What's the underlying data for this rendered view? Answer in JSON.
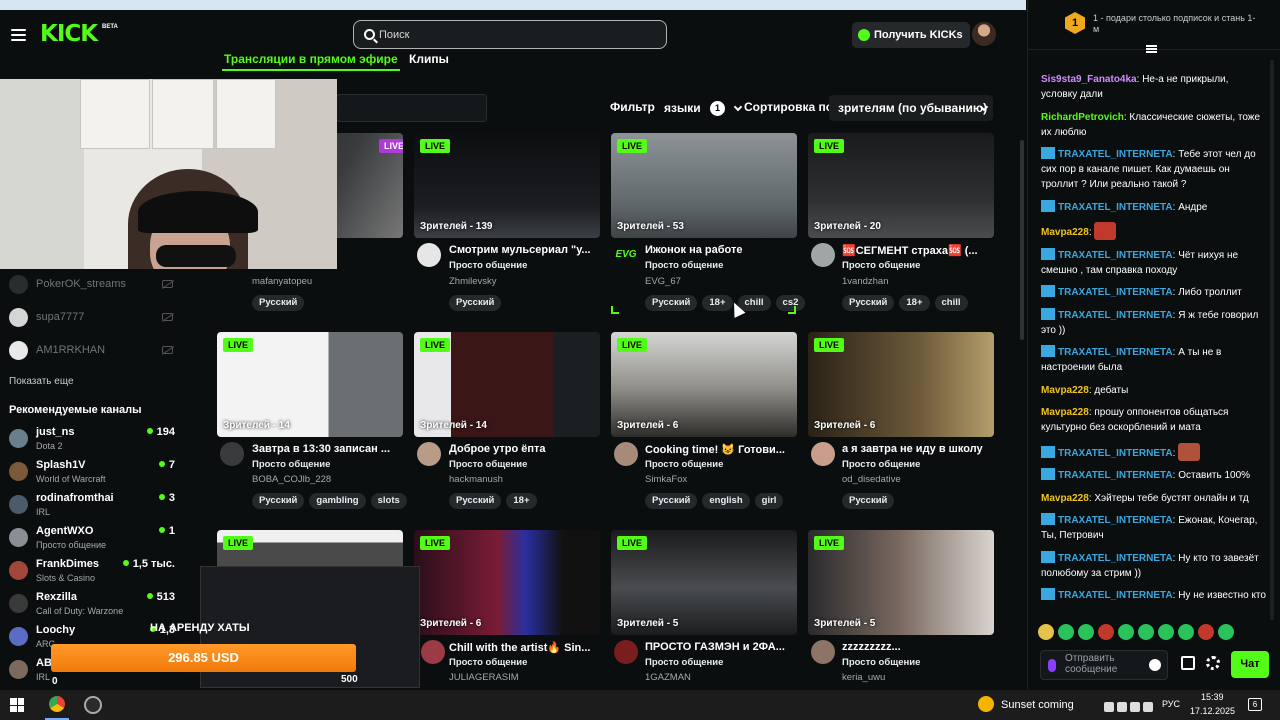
{
  "header": {
    "logo": "KICK",
    "logo_beta": "BETA",
    "search_placeholder": "Поиск",
    "get_kicks": "Получить KICKs"
  },
  "tabs": {
    "live": "Трансляции в прямом эфире",
    "clips": "Клипы"
  },
  "filters": {
    "filter_label": "Фильтр",
    "languages_label": "языки",
    "languages_count": "1",
    "sort_label": "Сортировка по",
    "sort_value": "зрителям (по убыванию)"
  },
  "sidebar": {
    "followed": [
      {
        "name": "PokerOK_streams"
      },
      {
        "name": "supa7777"
      },
      {
        "name": "AM1RRKHAN"
      }
    ],
    "show_more": "Показать еще",
    "recommended_title": "Рекомендуемые каналы",
    "recommended": [
      {
        "name": "just_ns",
        "category": "Dota 2",
        "viewers": "194"
      },
      {
        "name": "Splash1V",
        "category": "World of Warcraft",
        "viewers": "7"
      },
      {
        "name": "rodinafromthai",
        "category": "IRL",
        "viewers": "3"
      },
      {
        "name": "AgentWXO",
        "category": "Просто общение",
        "viewers": "1"
      },
      {
        "name": "FrankDimes",
        "category": "Slots & Casino",
        "viewers": "1,5 тыс."
      },
      {
        "name": "Rexzilla",
        "category": "Call of Duty: Warzone",
        "viewers": "513"
      },
      {
        "name": "Loochy",
        "category": "ARC",
        "viewers": "1,3"
      },
      {
        "name": "AB",
        "category": "IRL",
        "viewers": ""
      }
    ]
  },
  "streams": [
    {
      "live": "LIVE",
      "viewers": "",
      "title": "",
      "category": "",
      "user": "mafanyatopeu",
      "tags": [
        "Русский"
      ]
    },
    {
      "live": "LIVE",
      "viewers": "Зрителей - 139",
      "title": "Смотрим мульсериал \"у...",
      "category": "Просто общение",
      "user": "Zhmilevsky",
      "tags": [
        "Русский"
      ]
    },
    {
      "live": "LIVE",
      "viewers": "Зрителей - 53",
      "title": "Ижонок на работе",
      "category": "Просто общение",
      "user": "EVG_67",
      "avatar_text": "EVG",
      "tags": [
        "Русский",
        "18+",
        "chill",
        "cs2"
      ]
    },
    {
      "live": "LIVE",
      "viewers": "Зрителей - 20",
      "title": "🆘СЕГМЕНТ страха🆘 (...",
      "category": "Просто общение",
      "user": "1vandzhan",
      "tags": [
        "Русский",
        "18+",
        "chill"
      ]
    },
    {
      "live": "LIVE",
      "viewers": "Зрителей - 14",
      "title": "Завтра в 13:30 записан ...",
      "category": "Просто общение",
      "user": "BOBA_COJlb_228",
      "tags": [
        "Русский",
        "gambling",
        "slots"
      ]
    },
    {
      "live": "LIVE",
      "viewers": "Зрителей - 14",
      "title": "Доброе утро ёпта",
      "category": "Просто общение",
      "user": "hackmanush",
      "tags": [
        "Русский",
        "18+"
      ]
    },
    {
      "live": "LIVE",
      "viewers": "Зрителей - 6",
      "title": "Cooking time! 😺 Готови...",
      "category": "Просто общение",
      "user": "SimkaFox",
      "tags": [
        "Русский",
        "english",
        "girl"
      ]
    },
    {
      "live": "LIVE",
      "viewers": "Зрителей - 6",
      "title": "а я завтра не иду в школу",
      "category": "Просто общение",
      "user": "od_disedative",
      "tags": [
        "Русский"
      ]
    },
    {
      "live": "LIVE",
      "viewers": "",
      "title": "",
      "category": "",
      "user": "",
      "tags": []
    },
    {
      "live": "LIVE",
      "viewers": "Зрителей - 6",
      "title": "Chill with the artist🔥 Sin...",
      "category": "Просто общение",
      "user": "JULIAGERASIM",
      "tags": []
    },
    {
      "live": "LIVE",
      "viewers": "Зрителей - 5",
      "title": "ПРОСТО ГАЗМЭН и 2ФА...",
      "category": "Просто общение",
      "user": "1GAZMAN",
      "tags": []
    },
    {
      "live": "LIVE",
      "viewers": "Зрителей - 5",
      "title": "zzzzzzzzz...",
      "category": "Просто общение",
      "user": "keria_uwu",
      "tags": []
    }
  ],
  "overlay": {
    "rent_text": "НА АРЕНДУ ХАТЫ",
    "donation": "296.85 USD",
    "counter": "500",
    "zero": "0"
  },
  "chat": {
    "rank": "1",
    "rank_text": "1 - подари столько подписок и стань 1-м",
    "messages": [
      {
        "user": "Sis9sta9_Fanato4ka",
        "color": "#d08cff",
        "badge": false,
        "text": "Не-а не прикрыли, условку дали"
      },
      {
        "user": "RichardPetrovich",
        "color": "#53fc18",
        "badge": false,
        "text": "Классические сюжеты, тоже их люблю"
      },
      {
        "user": "TRAXATEL_INTERNETA",
        "color": "#3aa8e0",
        "badge": true,
        "text": "Тебе этот чел до сих пор в канале пишет. Как думаешь он троллит ? Или реально такой ?"
      },
      {
        "user": "TRAXATEL_INTERNETA",
        "color": "#3aa8e0",
        "badge": true,
        "text": "Андре"
      },
      {
        "user": "Mavpa228",
        "color": "#f0c419",
        "badge": false,
        "text": "",
        "emote": true
      },
      {
        "user": "TRAXATEL_INTERNETA",
        "color": "#3aa8e0",
        "badge": true,
        "text": "Чёт нихуя не смешно , там справка походу"
      },
      {
        "user": "TRAXATEL_INTERNETA",
        "color": "#3aa8e0",
        "badge": true,
        "text": "Либо троллит"
      },
      {
        "user": "TRAXATEL_INTERNETA",
        "color": "#3aa8e0",
        "badge": true,
        "text": "Я ж тебе говорил это ))"
      },
      {
        "user": "TRAXATEL_INTERNETA",
        "color": "#3aa8e0",
        "badge": true,
        "text": "А ты не в настроении была"
      },
      {
        "user": "Mavpa228",
        "color": "#f0c419",
        "badge": false,
        "text": "дебаты"
      },
      {
        "user": "Mavpa228",
        "color": "#f0c419",
        "badge": false,
        "text": "прошу оппонентов общаться культурно без оскорблений и мата"
      },
      {
        "user": "TRAXATEL_INTERNETA",
        "color": "#3aa8e0",
        "badge": true,
        "text": "",
        "emote": true
      },
      {
        "user": "TRAXATEL_INTERNETA",
        "color": "#3aa8e0",
        "badge": true,
        "text": "Оставить 100%"
      },
      {
        "user": "Mavpa228",
        "color": "#f0c419",
        "badge": false,
        "text": "Хэйтеры тебе бустят онлайн и тд"
      },
      {
        "user": "TRAXATEL_INTERNETA",
        "color": "#3aa8e0",
        "badge": true,
        "text": "Ежонак, Кочегар, Ты, Петрович"
      },
      {
        "user": "TRAXATEL_INTERNETA",
        "color": "#3aa8e0",
        "badge": true,
        "text": "Ну кто то завезёт полюбому за стрим ))"
      },
      {
        "user": "TRAXATEL_INTERNETA",
        "color": "#3aa8e0",
        "badge": true,
        "text": "Ну не известно кто"
      }
    ],
    "input_placeholder": "Отправить сообщение",
    "send_label": "Чат"
  },
  "taskbar": {
    "weather": "Sunset coming",
    "lang": "РУС",
    "time": "15:39",
    "date": "17.12.2025",
    "notifications": "6"
  }
}
